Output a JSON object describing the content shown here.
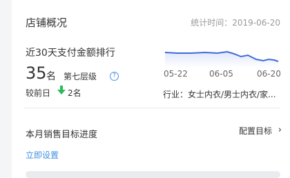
{
  "card": {
    "title": "店铺概况",
    "stat_time": "统计时间：2019-06-20"
  },
  "rank": {
    "label": "近30天支付金额排行",
    "number": "35",
    "unit": "名",
    "level": "第七层级",
    "help_icon": "question-circle-icon",
    "compare_label": "较前日",
    "compare_icon": "arrow-down-icon",
    "compare_color": "#2dbb5a",
    "compare_value": "2名"
  },
  "trend": {
    "x_labels": [
      "05-22",
      "06-05",
      "06-20"
    ],
    "industry": "行业：女士内衣/男士内衣/家...",
    "line_color": "#3f6ad8"
  },
  "goal": {
    "title": "本月销售目标进度",
    "config_label": "配置目标",
    "config_icon": "chevron-right-icon",
    "set_now": "立即设置",
    "progress": 0
  }
}
